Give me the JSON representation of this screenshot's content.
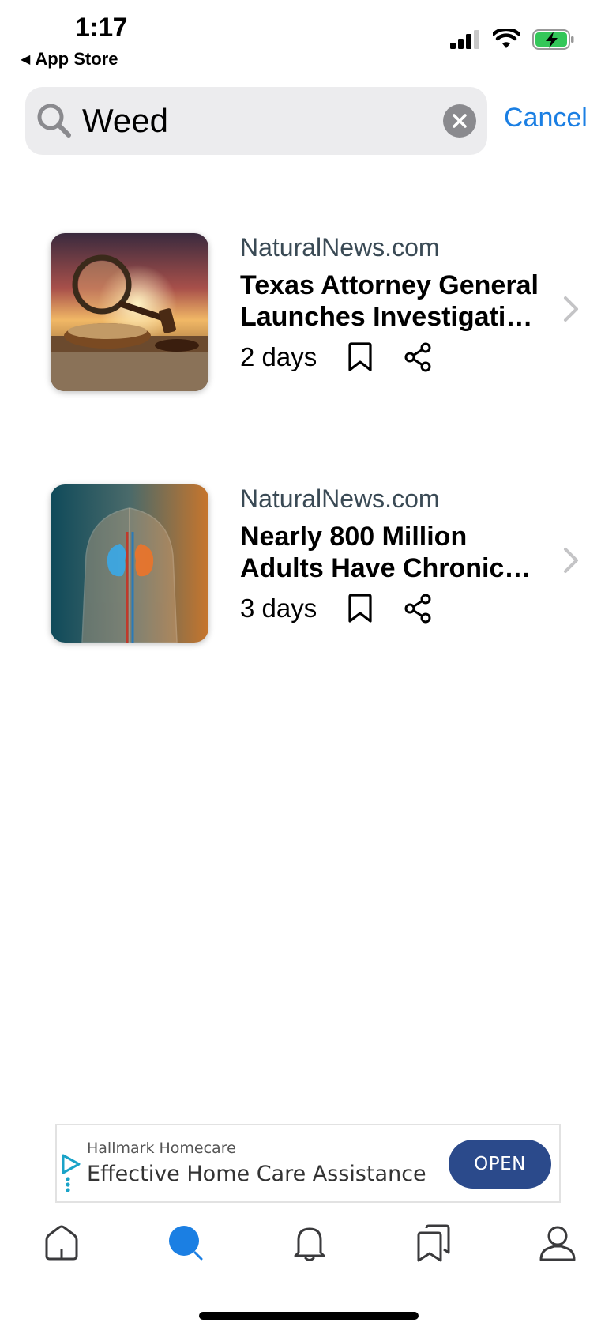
{
  "status_bar": {
    "time": "1:17",
    "back_app": "App Store",
    "icons": [
      "cellular-signal-icon",
      "wifi-icon",
      "battery-charging-icon"
    ],
    "battery_color": "#34c759"
  },
  "search": {
    "query": "Weed",
    "cancel_label": "Cancel",
    "accent": "#1b7fe3"
  },
  "articles": [
    {
      "source": "NaturalNews.com",
      "title": "Texas Attorney General Launches Investigati…",
      "age": "2 days",
      "thumbnail": "magnifying-glass-gavel-grain-bowl"
    },
    {
      "source": "NaturalNews.com",
      "title": "Nearly 800 Million Adults Have Chronic…",
      "age": "3 days",
      "thumbnail": "human-torso-kidneys"
    }
  ],
  "ad": {
    "sponsor": "Hallmark Homecare",
    "headline": "Effective Home Care Assistance",
    "cta": "OPEN",
    "cta_color": "#2b4a8b"
  },
  "tab_bar": {
    "tabs": [
      "home-icon",
      "search-icon",
      "bell-icon",
      "bookmarks-icon",
      "profile-icon"
    ],
    "active": "search-icon",
    "active_color": "#1b7fe3"
  }
}
